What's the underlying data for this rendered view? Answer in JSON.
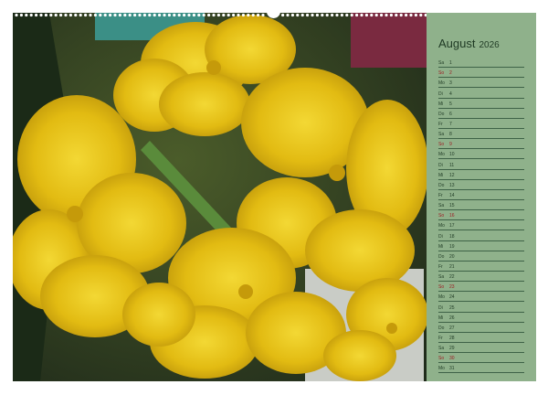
{
  "calendar": {
    "month": "August",
    "year": "2026",
    "days": [
      {
        "weekday": "Sa",
        "day": "1",
        "sunday": false
      },
      {
        "weekday": "So",
        "day": "2",
        "sunday": true
      },
      {
        "weekday": "Mo",
        "day": "3",
        "sunday": false
      },
      {
        "weekday": "Di",
        "day": "4",
        "sunday": false
      },
      {
        "weekday": "Mi",
        "day": "5",
        "sunday": false
      },
      {
        "weekday": "Do",
        "day": "6",
        "sunday": false
      },
      {
        "weekday": "Fr",
        "day": "7",
        "sunday": false
      },
      {
        "weekday": "Sa",
        "day": "8",
        "sunday": false
      },
      {
        "weekday": "So",
        "day": "9",
        "sunday": true
      },
      {
        "weekday": "Mo",
        "day": "10",
        "sunday": false
      },
      {
        "weekday": "Di",
        "day": "11",
        "sunday": false
      },
      {
        "weekday": "Mi",
        "day": "12",
        "sunday": false
      },
      {
        "weekday": "Do",
        "day": "13",
        "sunday": false
      },
      {
        "weekday": "Fr",
        "day": "14",
        "sunday": false
      },
      {
        "weekday": "Sa",
        "day": "15",
        "sunday": false
      },
      {
        "weekday": "So",
        "day": "16",
        "sunday": true
      },
      {
        "weekday": "Mo",
        "day": "17",
        "sunday": false
      },
      {
        "weekday": "Di",
        "day": "18",
        "sunday": false
      },
      {
        "weekday": "Mi",
        "day": "19",
        "sunday": false
      },
      {
        "weekday": "Do",
        "day": "20",
        "sunday": false
      },
      {
        "weekday": "Fr",
        "day": "21",
        "sunday": false
      },
      {
        "weekday": "Sa",
        "day": "22",
        "sunday": false
      },
      {
        "weekday": "So",
        "day": "23",
        "sunday": true
      },
      {
        "weekday": "Mo",
        "day": "24",
        "sunday": false
      },
      {
        "weekday": "Di",
        "day": "25",
        "sunday": false
      },
      {
        "weekday": "Mi",
        "day": "26",
        "sunday": false
      },
      {
        "weekday": "Do",
        "day": "27",
        "sunday": false
      },
      {
        "weekday": "Fr",
        "day": "28",
        "sunday": false
      },
      {
        "weekday": "Sa",
        "day": "29",
        "sunday": false
      },
      {
        "weekday": "So",
        "day": "30",
        "sunday": true
      },
      {
        "weekday": "Mo",
        "day": "31",
        "sunday": false
      }
    ]
  },
  "colors": {
    "panel": "#8fb18b",
    "text": "#1f3a24",
    "sunday": "#9e1c23",
    "flower": "#e8c21a"
  },
  "photo": {
    "subject": "yellow-orchid-flowers"
  }
}
